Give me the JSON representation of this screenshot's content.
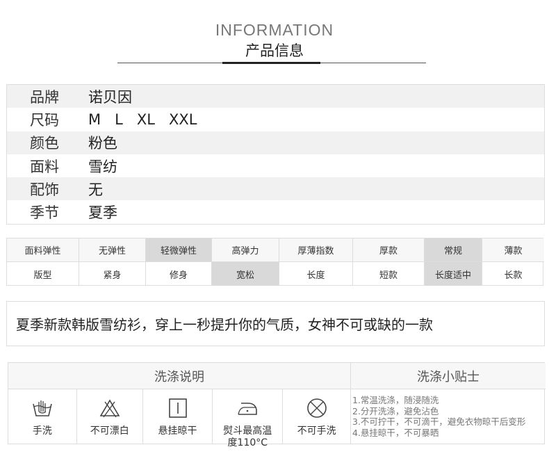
{
  "header": {
    "title_en": "INFORMATION",
    "title_cn": "产品信息"
  },
  "info": [
    {
      "key": "品牌",
      "value": "诺贝因"
    },
    {
      "key": "尺码",
      "value": "M   L   XL   XXL"
    },
    {
      "key": "颜色",
      "value": "粉色"
    },
    {
      "key": "面料",
      "value": "雪纺"
    },
    {
      "key": "配饰",
      "value": "无"
    },
    {
      "key": "季节",
      "value": "夏季"
    }
  ],
  "attributes": {
    "row1": [
      "面料弹性",
      "无弹性",
      "轻微弹性",
      "高弹力",
      "厚薄指数",
      "厚款",
      "常规",
      "薄款"
    ],
    "row2": [
      "版型",
      "紧身",
      "修身",
      "宽松",
      "长度",
      "短款",
      "长度适中",
      "长款"
    ]
  },
  "description": "夏季新款韩版雪纺衫，穿上一秒提升你的气质，女神不可或缺的一款",
  "wash": {
    "title_left": "洗涤说明",
    "title_right": "洗涤小贴士",
    "icons": [
      {
        "icon": "hand-wash-icon",
        "label": "手洗"
      },
      {
        "icon": "no-bleach-icon",
        "label": "不可漂白"
      },
      {
        "icon": "hang-dry-icon",
        "label": "悬挂晾干"
      },
      {
        "icon": "iron-icon",
        "label": "熨斗最高温度110°C"
      },
      {
        "icon": "no-hand-wash-icon",
        "label": "不可手洗"
      }
    ],
    "tips": [
      "1.常温洗涤，随浸随洗",
      "2.分开洗涤，避免沾色",
      "3.不可拧干，不可滴干，避免衣物晾干后变形",
      "4.悬挂晾干，不可暴晒"
    ]
  }
}
